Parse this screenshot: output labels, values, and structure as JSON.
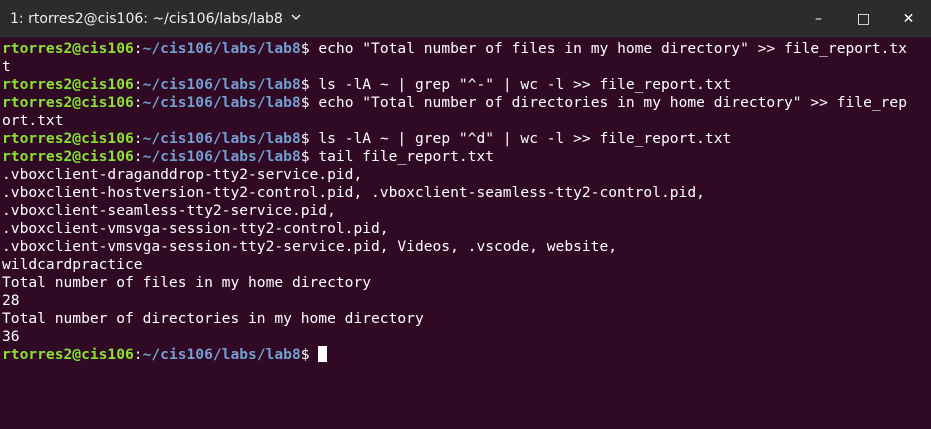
{
  "window": {
    "title": "1: rtorres2@cis106: ~/cis106/labs/lab8",
    "minimize_glyph": "–",
    "maximize_glyph": "□",
    "close_glyph": "✕"
  },
  "prompt": {
    "user_host": "rtorres2@cis106",
    "colon": ":",
    "path": "~/cis106/labs/lab8",
    "symbol": "$"
  },
  "commands": [
    " echo \"Total number of files in my home directory\" >> file_report.tx",
    " ls -lA ~ | grep \"^-\" | wc -l >> file_report.txt",
    " echo \"Total number of directories in my home directory\" >> file_rep",
    " ls -lA ~ | grep \"^d\" | wc -l >> file_report.txt",
    " tail file_report.txt",
    " "
  ],
  "wraps": {
    "cmd1": "t",
    "cmd3": "ort.txt"
  },
  "output": [
    ".vboxclient-draganddrop-tty2-service.pid,",
    ".vboxclient-hostversion-tty2-control.pid, .vboxclient-seamless-tty2-control.pid,",
    ".vboxclient-seamless-tty2-service.pid,",
    ".vboxclient-vmsvga-session-tty2-control.pid,",
    ".vboxclient-vmsvga-session-tty2-service.pid, Videos, .vscode, website,",
    "wildcardpractice",
    "Total number of files in my home directory",
    "28",
    "Total number of directories in my home directory",
    "36"
  ],
  "colors": {
    "background": "#300a24",
    "titlebar": "#2c2c2c",
    "user_host": "#8ae234",
    "path": "#729fcf",
    "text": "#ffffff"
  }
}
